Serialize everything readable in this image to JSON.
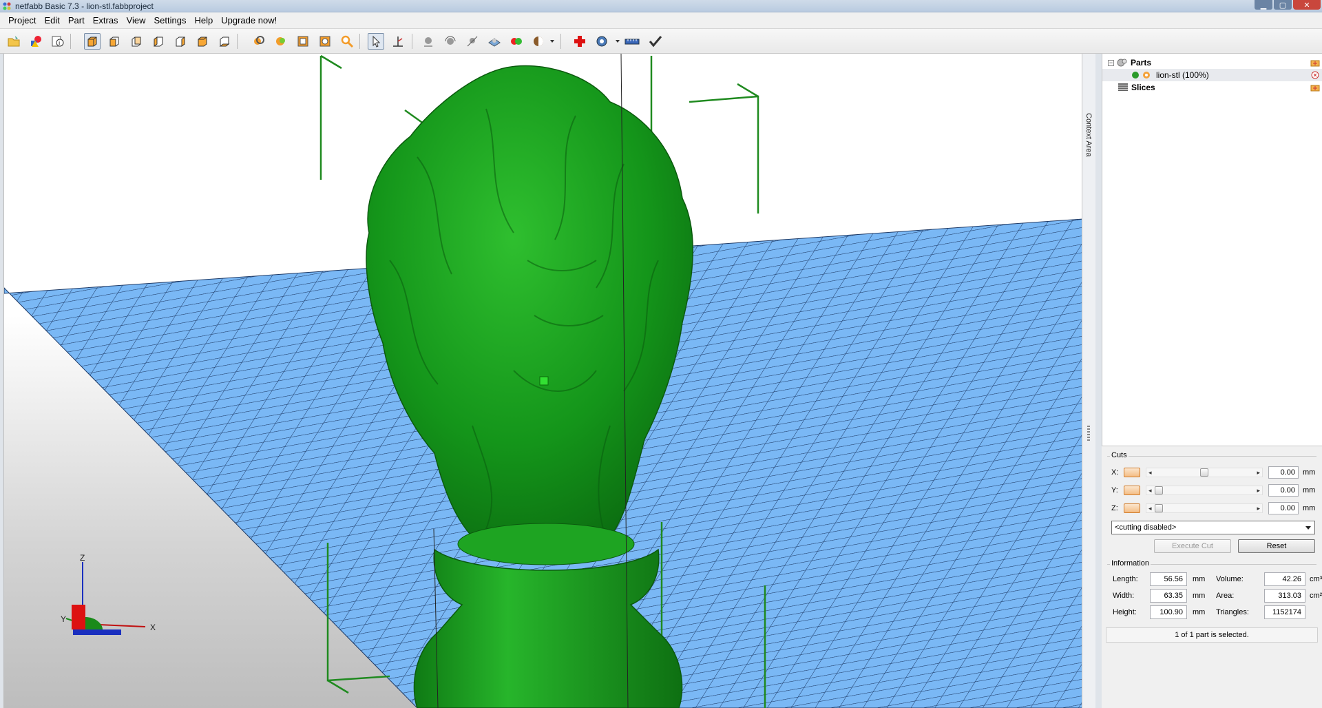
{
  "window": {
    "title": "netfabb Basic 7.3 - lion-stl.fabbproject",
    "controls": [
      "minimize",
      "maximize",
      "close"
    ]
  },
  "menu": [
    "Project",
    "Edit",
    "Part",
    "Extras",
    "View",
    "Settings",
    "Help",
    "Upgrade now!"
  ],
  "toolbar": {
    "icons": [
      "open-project-icon",
      "add-part-icon",
      "part-info-icon",
      "view-3d-icon",
      "view-front-icon",
      "view-back-icon",
      "view-left-icon",
      "view-right-icon",
      "view-top-icon",
      "view-bottom-icon",
      "zoom-in-icon",
      "zoom-selection-icon",
      "zoom-all-icon",
      "zoom-part-icon",
      "zoom-magnifier-icon",
      "select-tool-icon",
      "measure-tool-icon",
      "move-part-icon",
      "rotate-part-icon",
      "scale-part-icon",
      "arrange-icon",
      "color-icon",
      "shade-mode-icon",
      "repair-icon",
      "analyze-icon",
      "ruler-icon",
      "checkmark-icon"
    ]
  },
  "viewport": {
    "part_color": "#1a9c1a",
    "platform_color": "#7ab8f5",
    "axes": {
      "x": "X",
      "y": "Y",
      "z": "Z"
    }
  },
  "context_tab": {
    "label": "Context Area"
  },
  "tree": {
    "parts_label": "Parts",
    "part_item": "lion-stl (100%)",
    "slices_label": "Slices"
  },
  "cuts": {
    "title": "Cuts",
    "rows": [
      {
        "axis": "X:",
        "value": "0.00",
        "unit": "mm",
        "thumb_fraction": 0.5
      },
      {
        "axis": "Y:",
        "value": "0.00",
        "unit": "mm",
        "thumb_fraction": 0.0
      },
      {
        "axis": "Z:",
        "value": "0.00",
        "unit": "mm",
        "thumb_fraction": 0.0
      }
    ],
    "mode_select": "<cutting disabled>",
    "execute_label": "Execute Cut",
    "reset_label": "Reset"
  },
  "info": {
    "title": "Information",
    "length_label": "Length:",
    "length_value": "56.56",
    "length_unit": "mm",
    "width_label": "Width:",
    "width_value": "63.35",
    "width_unit": "mm",
    "height_label": "Height:",
    "height_value": "100.90",
    "height_unit": "mm",
    "volume_label": "Volume:",
    "volume_value": "42.26",
    "volume_unit": "cm³",
    "area_label": "Area:",
    "area_value": "313.03",
    "area_unit": "cm²",
    "triangles_label": "Triangles:",
    "triangles_value": "1152174"
  },
  "status": "1 of 1 part is selected."
}
